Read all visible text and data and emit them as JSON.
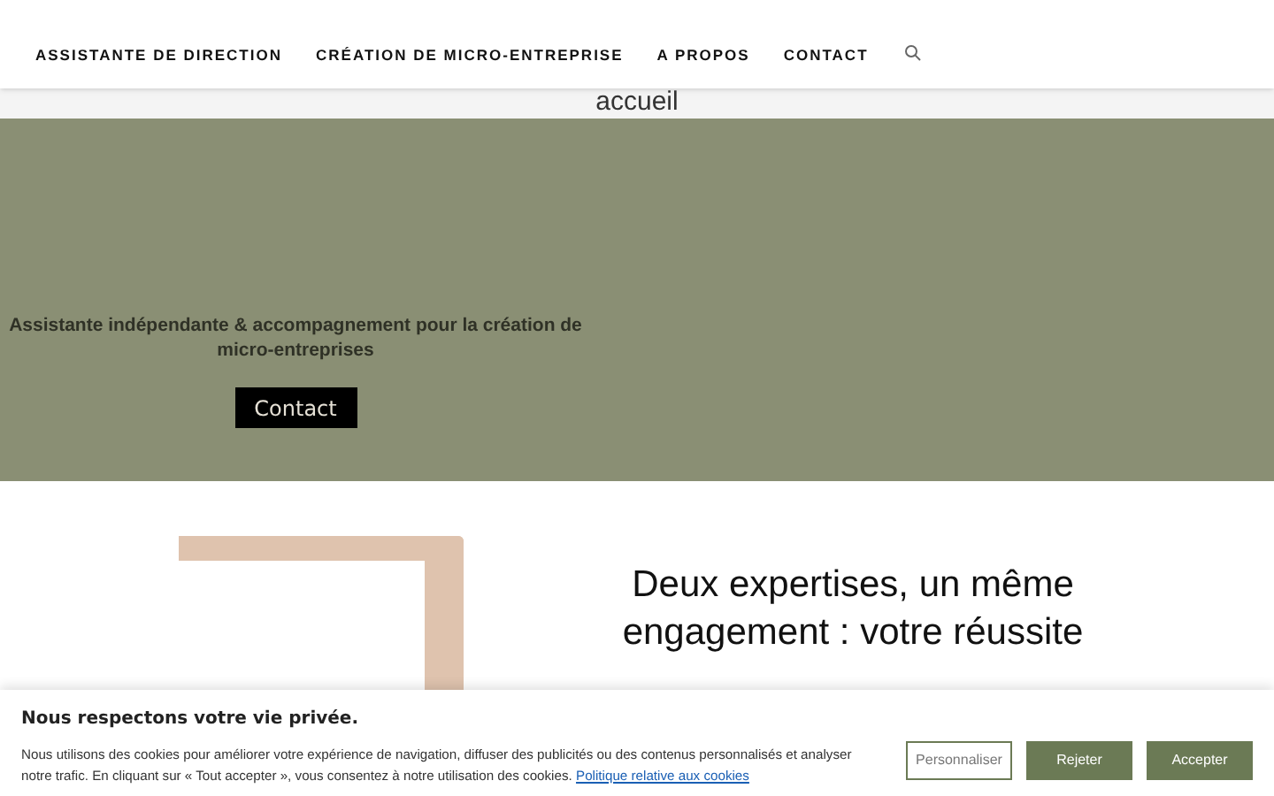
{
  "nav": {
    "items": [
      {
        "label": "ASSISTANTE DE DIRECTION"
      },
      {
        "label": "CRÉATION DE MICRO-ENTREPRISE"
      },
      {
        "label": "A PROPOS"
      },
      {
        "label": "CONTACT"
      }
    ]
  },
  "page_title": "accueil",
  "hero": {
    "tagline": "Assistante indépendante & accompagnement pour la création de micro-entreprises",
    "button": "Contact"
  },
  "section": {
    "heading": "Deux expertises, un même engagement : votre réussite"
  },
  "cookie_banner": {
    "title": "Nous respectons votre vie privée.",
    "text": "Nous utilisons des cookies pour améliorer votre expérience de navigation, diffuser des publicités ou des contenus personnalisés et analyser notre trafic. En cliquant sur « Tout accepter », vous consentez à notre utilisation des cookies.",
    "link": "Politique relative aux cookies",
    "buttons": [
      {
        "label": "Personnaliser",
        "kind": "outline"
      },
      {
        "label": "Rejeter",
        "kind": "filled"
      },
      {
        "label": "Accepter",
        "kind": "filled"
      }
    ]
  }
}
